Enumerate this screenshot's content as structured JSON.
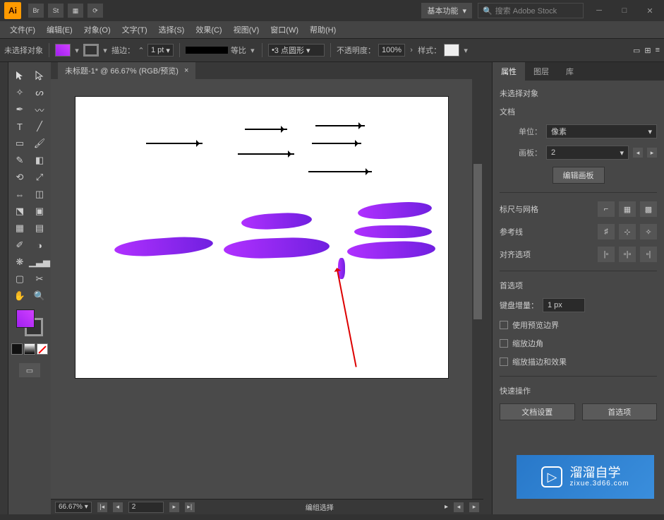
{
  "titlebar": {
    "logo": "Ai",
    "workspace_label": "基本功能",
    "search_placeholder": "搜索 Adobe Stock"
  },
  "menubar": {
    "items": [
      "文件(F)",
      "编辑(E)",
      "对象(O)",
      "文字(T)",
      "选择(S)",
      "效果(C)",
      "视图(V)",
      "窗口(W)",
      "帮助(H)"
    ]
  },
  "controlbar": {
    "selection": "未选择对象",
    "stroke_label": "描边：",
    "stroke_val": "1 pt",
    "uniform": "等比",
    "brush_val": "3 点圆形",
    "opacity_label": "不透明度：",
    "opacity_val": "100%",
    "style_label": "样式："
  },
  "doc": {
    "tab": "未标题-1* @ 66.67% (RGB/预览)"
  },
  "statusbar": {
    "zoom": "66.67%",
    "page": "2",
    "hint": "编组选择"
  },
  "panel": {
    "tabs": [
      "属性",
      "图层",
      "库"
    ],
    "no_selection": "未选择对象",
    "doc_section": "文档",
    "unit_label": "单位：",
    "unit_value": "像素",
    "artboard_label": "画板：",
    "artboard_value": "2",
    "edit_artboard": "编辑画板",
    "rulers_grid": "标尺与网格",
    "guides": "参考线",
    "align_options": "对齐选项",
    "prefs": "首选项",
    "kbd_inc_label": "键盘增量：",
    "kbd_inc_val": "1 px",
    "cb1": "使用预览边界",
    "cb2": "缩放边角",
    "cb3": "缩放描边和效果",
    "quick_ops": "快速操作",
    "doc_setup": "文档设置",
    "prefs_btn": "首选项"
  },
  "watermark": {
    "brand": "溜溜自学",
    "url": "zixue.3d66.com"
  }
}
